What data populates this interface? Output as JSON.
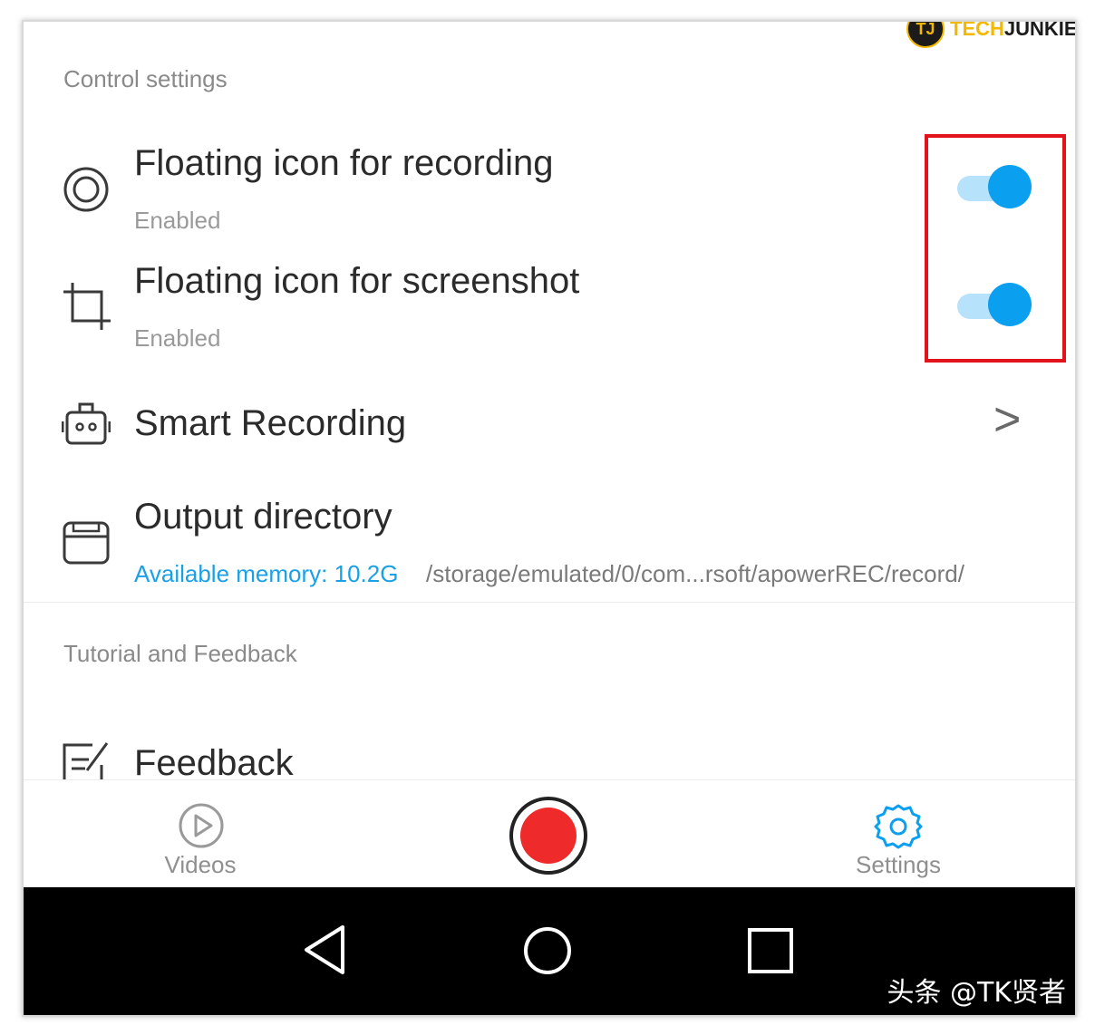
{
  "branding": {
    "logo_initials": "TJ",
    "logo_prefix": "TECH",
    "logo_suffix": "JUNKIE"
  },
  "control_settings": {
    "section_title": "Control settings",
    "rows": [
      {
        "title": "Floating icon for recording",
        "subtitle": "Enabled",
        "icon": "record-ring-icon",
        "toggle_on": true
      },
      {
        "title": "Floating icon for screenshot",
        "subtitle": "Enabled",
        "icon": "crop-icon",
        "toggle_on": true
      },
      {
        "title": "Smart Recording",
        "icon": "robot-icon",
        "chevron": ">"
      },
      {
        "title": "Output directory",
        "icon": "folder-icon",
        "memory_label": "Available memory: 10.2G",
        "path": "/storage/emulated/0/com...rsoft/apowerREC/record/"
      }
    ]
  },
  "tutorial_feedback": {
    "section_title": "Tutorial and Feedback",
    "rows": [
      {
        "title": "Feedback",
        "icon": "feedback-edit-icon"
      }
    ]
  },
  "bottom_tabs": {
    "videos_label": "Videos",
    "settings_label": "Settings",
    "record_button_color": "#ee2a2a"
  },
  "colors": {
    "accent": "#0b9ff0",
    "highlight_box": "#e3131b",
    "memory_text": "#1aa0e6"
  },
  "watermark": "头条 @TK贤者"
}
